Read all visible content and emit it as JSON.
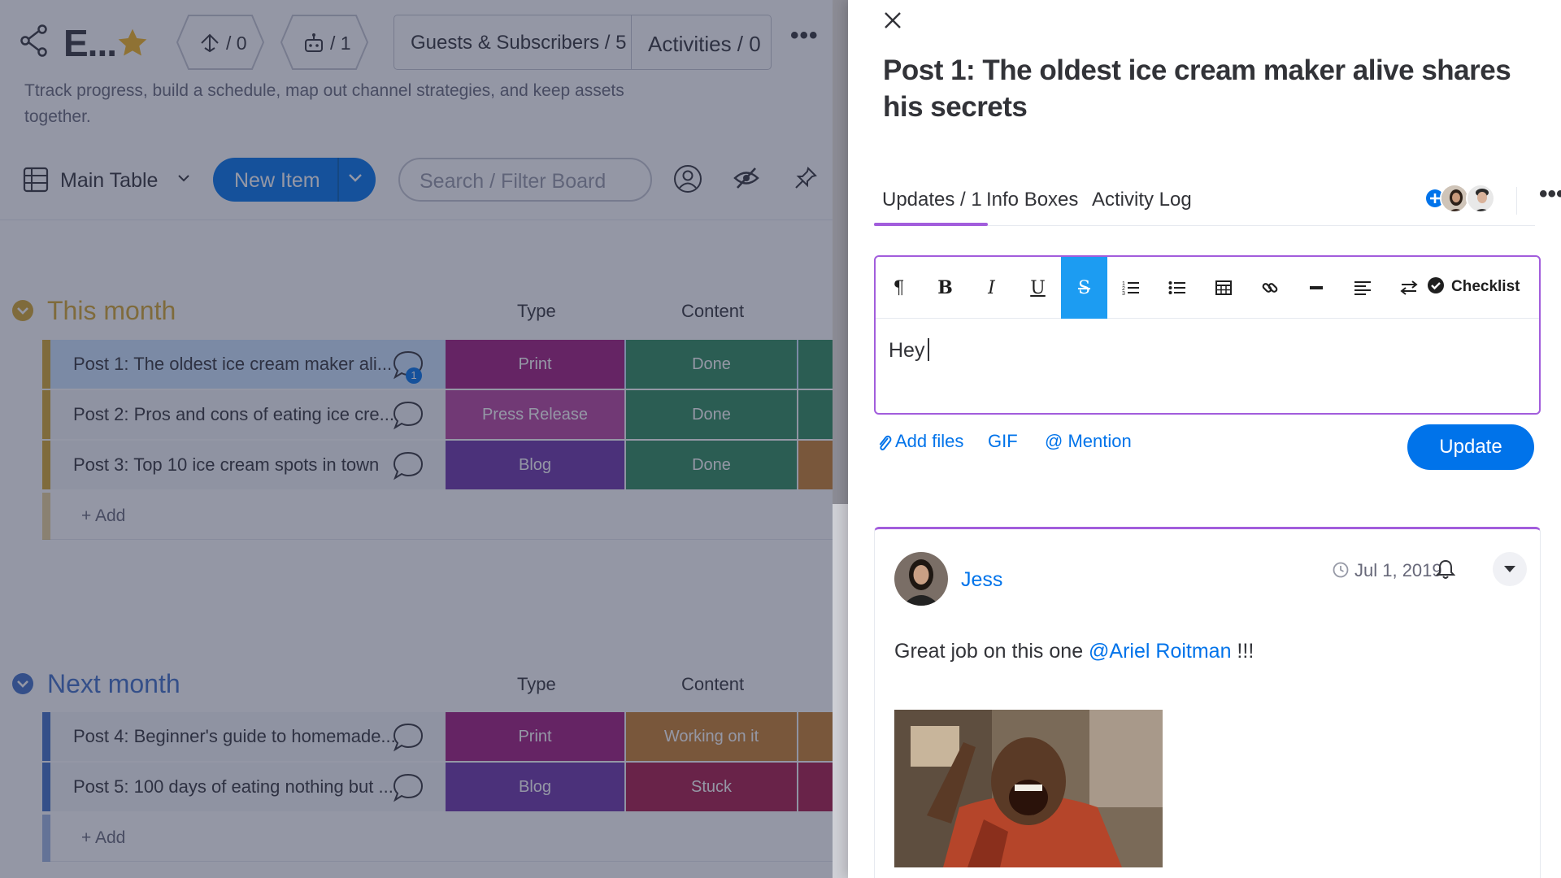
{
  "board": {
    "title": "E...",
    "automations_count": "/ 0",
    "integrations_count": "/ 1",
    "guests_label": "Guests & Subscribers / 5",
    "activities_label": "Activities / 0",
    "description": "Ttrack progress, build a schedule, map out channel strategies, and keep assets together.",
    "view_label": "Main Table",
    "new_item_label": "New Item",
    "search_placeholder": "Search / Filter Board",
    "groups": [
      {
        "name": "This month",
        "color": "#d5a72d",
        "col_type": "Type",
        "col_content": "Content",
        "add_label": "+ Add",
        "rows": [
          {
            "name": "Post 1: The oldest ice cream maker ali...",
            "type": "Print",
            "type_color": "#a1197d",
            "content": "Done",
            "content_color": "#2d8a5a",
            "bubble": "1"
          },
          {
            "name": "Post 2: Pros and cons of eating ice cre...",
            "type": "Press Release",
            "type_color": "#b8439e",
            "content": "Done",
            "content_color": "#2d8a5a",
            "bubble": ""
          },
          {
            "name": "Post 3: Top 10 ice cream spots in town",
            "type": "Blog",
            "type_color": "#6d32a8",
            "content": "Done",
            "content_color": "#2d8a5a",
            "bubble": ""
          }
        ]
      },
      {
        "name": "Next month",
        "color": "#3f6fc6",
        "col_type": "Type",
        "col_content": "Content",
        "add_label": "+ Add",
        "rows": [
          {
            "name": "Post 4: Beginner's guide to homemade...",
            "type": "Print",
            "type_color": "#a1197d",
            "content": "Working on it",
            "content_color": "#c97f2b",
            "bubble": ""
          },
          {
            "name": "Post 5: 100 days of eating nothing but ...",
            "type": "Blog",
            "type_color": "#6d32a8",
            "content": "Stuck",
            "content_color": "#a81747",
            "bubble": ""
          }
        ]
      }
    ]
  },
  "panel": {
    "title": "Post 1: The oldest ice cream maker alive shares his secrets",
    "tabs": [
      "Updates / 1",
      "Info Boxes",
      "Activity Log"
    ],
    "toolbar": {
      "paragraph": "¶",
      "bold": "B",
      "italic": "I",
      "underline": "U",
      "strike": "S",
      "checklist": "Checklist"
    },
    "editor_text": "Hey",
    "attach": {
      "add_files": "Add files",
      "gif": "GIF",
      "mention": "@ Mention"
    },
    "update_button": "Update",
    "post": {
      "author": "Jess",
      "date": "Jul 1, 2019",
      "body_prefix": "Great job on this one ",
      "mention": "@Ariel Roitman",
      "body_suffix": " !!!"
    }
  },
  "colors": {
    "accent_purple": "#a25ddc",
    "primary_blue": "#0073ea",
    "toolbar_active": "#1c9cf2"
  }
}
